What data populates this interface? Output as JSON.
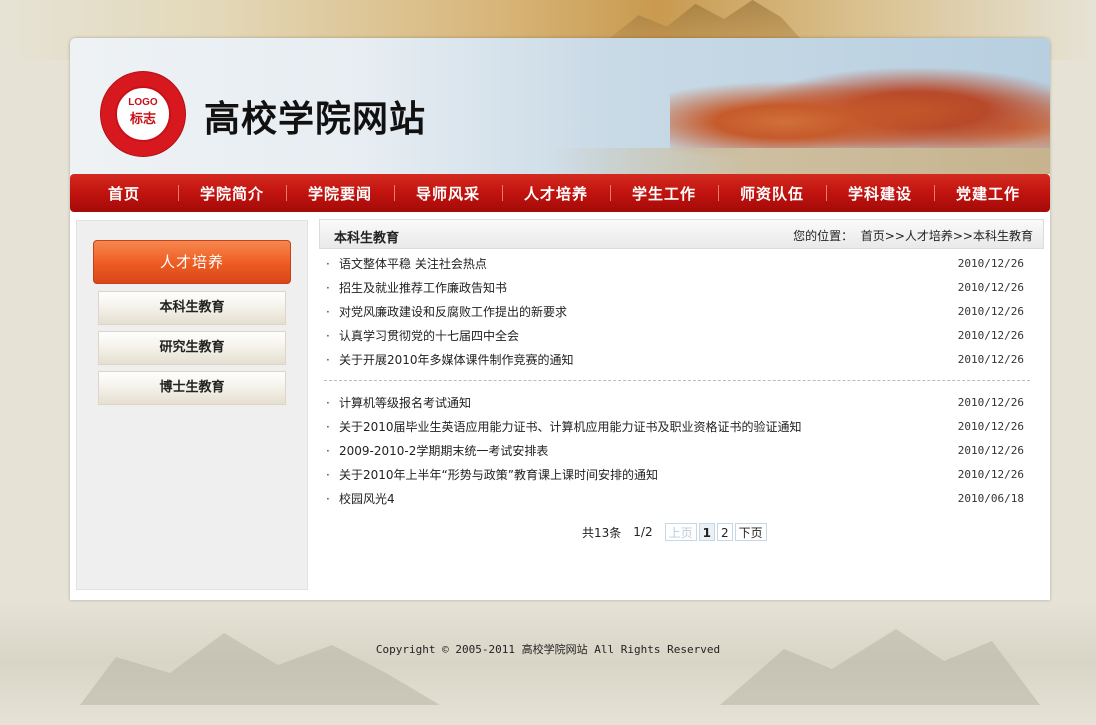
{
  "site": {
    "logo_top": "LOGO",
    "logo_bottom": "标志",
    "title": "高校学院网站"
  },
  "nav": [
    "首页",
    "学院简介",
    "学院要闻",
    "导师风采",
    "人才培养",
    "学生工作",
    "师资队伍",
    "学科建设",
    "党建工作"
  ],
  "sidebar": {
    "title": "人才培养",
    "items": [
      "本科生教育",
      "研究生教育",
      "博士生教育"
    ]
  },
  "content": {
    "heading": "本科生教育",
    "location_label": "您的位置：",
    "breadcrumb": "首页>>人才培养>>本科生教育",
    "news_group1": [
      {
        "title": "语文整体平稳 关注社会热点",
        "date": "2010/12/26"
      },
      {
        "title": "招生及就业推荐工作廉政告知书",
        "date": "2010/12/26"
      },
      {
        "title": "对党风廉政建设和反腐败工作提出的新要求",
        "date": "2010/12/26"
      },
      {
        "title": "认真学习贯彻党的十七届四中全会",
        "date": "2010/12/26"
      },
      {
        "title": "关于开展2010年多媒体课件制作竞赛的通知",
        "date": "2010/12/26"
      }
    ],
    "news_group2": [
      {
        "title": "计算机等级报名考试通知",
        "date": "2010/12/26"
      },
      {
        "title": "关于2010届毕业生英语应用能力证书、计算机应用能力证书及职业资格证书的验证通知",
        "date": "2010/12/26"
      },
      {
        "title": "2009-2010-2学期期末统一考试安排表",
        "date": "2010/12/26"
      },
      {
        "title": "关于2010年上半年“形势与政策”教育课上课时间安排的通知",
        "date": "2010/12/26"
      },
      {
        "title": "校园风光4",
        "date": "2010/06/18"
      }
    ]
  },
  "pager": {
    "total": "共13条",
    "page": "1/2",
    "prev": "上页",
    "pages": [
      "1",
      "2"
    ],
    "next": "下页"
  },
  "footer": "Copyright © 2005-2011 高校学院网站 All Rights Reserved",
  "colors": {
    "nav_red": "#c1130f",
    "sidebar_orange": "#ed5b22",
    "logo_red": "#d7191f"
  }
}
